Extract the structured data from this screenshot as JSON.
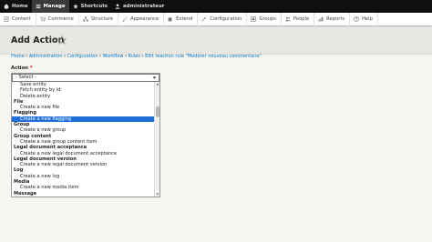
{
  "toolbar": {
    "items": [
      {
        "label": "Home",
        "icon": "drupal-icon"
      },
      {
        "label": "Manage",
        "icon": "menu-icon",
        "active": true
      },
      {
        "label": "Shortcuts",
        "icon": "star-icon"
      },
      {
        "label": "administrateur",
        "icon": "user-icon"
      }
    ]
  },
  "tray": {
    "items": [
      {
        "label": "Content",
        "icon": "content-icon"
      },
      {
        "label": "Commerce",
        "icon": "cart-icon"
      },
      {
        "label": "Structure",
        "icon": "structure-icon"
      },
      {
        "label": "Appearance",
        "icon": "appearance-icon"
      },
      {
        "label": "Extend",
        "icon": "puzzle-icon"
      },
      {
        "label": "Configuration",
        "icon": "wrench-icon"
      },
      {
        "label": "Groups",
        "icon": "groups-icon"
      },
      {
        "label": "People",
        "icon": "people-icon"
      },
      {
        "label": "Reports",
        "icon": "reports-icon"
      },
      {
        "label": "Help",
        "icon": "help-icon"
      }
    ]
  },
  "page": {
    "title": "Add Action"
  },
  "breadcrumb": [
    "Home",
    "Administration",
    "Configuration",
    "Workflow",
    "Rules",
    "Edit reaction rule \"Modérer nouveau commentaire\""
  ],
  "form": {
    "action_label": "Action",
    "required_mark": "*",
    "select_value": "- Select -",
    "options": [
      {
        "label": "Save entity",
        "kind": "child"
      },
      {
        "label": "Fetch entity by id",
        "kind": "child"
      },
      {
        "label": "Delete entity",
        "kind": "child"
      },
      {
        "label": "File",
        "kind": "group"
      },
      {
        "label": "Create a new file",
        "kind": "child"
      },
      {
        "label": "Flagging",
        "kind": "group"
      },
      {
        "label": "Create a new flagging",
        "kind": "child",
        "selected": true
      },
      {
        "label": "Group",
        "kind": "group"
      },
      {
        "label": "Create a new group",
        "kind": "child"
      },
      {
        "label": "Group content",
        "kind": "group"
      },
      {
        "label": "Create a new group content item",
        "kind": "child"
      },
      {
        "label": "Legal document acceptance",
        "kind": "group"
      },
      {
        "label": "Create a new legal document acceptance",
        "kind": "child"
      },
      {
        "label": "Legal document version",
        "kind": "group"
      },
      {
        "label": "Create a new legal document version",
        "kind": "child"
      },
      {
        "label": "Log",
        "kind": "group"
      },
      {
        "label": "Create a new log",
        "kind": "child"
      },
      {
        "label": "Media",
        "kind": "group"
      },
      {
        "label": "Create a new media item",
        "kind": "child"
      },
      {
        "label": "Message",
        "kind": "group"
      }
    ]
  },
  "colors": {
    "toolbar_bg": "#0f0f0f",
    "link": "#0074bd",
    "selected_option": "#1e6fd9"
  }
}
